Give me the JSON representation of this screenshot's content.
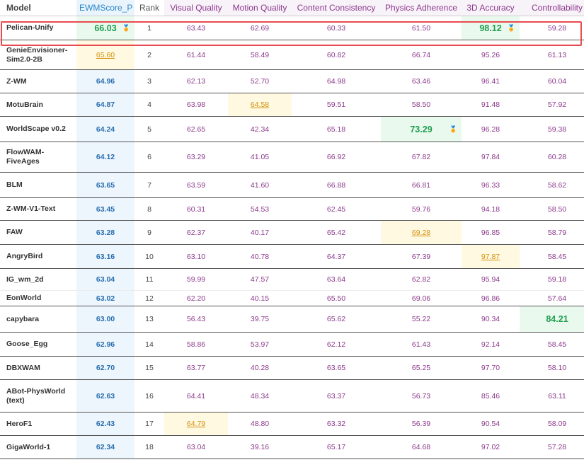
{
  "headers": {
    "model": "Model",
    "ewm": "EWMScore_P",
    "rank": "Rank",
    "visual_quality": "Visual Quality",
    "motion_quality": "Motion Quality",
    "content_consistency": "Content Consistency",
    "physics_adherence": "Physics Adherence",
    "accuracy_3d": "3D Accuracy",
    "controllability": "Controllability"
  },
  "rows": [
    {
      "model": "Pelican-Unify",
      "ewm": "66.03",
      "rank": "1",
      "vq": "63.43",
      "mq": "62.69",
      "cc": "60.33",
      "pa": "61.50",
      "ac": "98.12",
      "ct": "59.28"
    },
    {
      "model": "GenieEnvisioner-Sim2.0-2B",
      "ewm": "65.60",
      "rank": "2",
      "vq": "61.44",
      "mq": "58.49",
      "cc": "60.82",
      "pa": "66.74",
      "ac": "95.26",
      "ct": "61.13"
    },
    {
      "model": "Z-WM",
      "ewm": "64.96",
      "rank": "3",
      "vq": "62.13",
      "mq": "52.70",
      "cc": "64.98",
      "pa": "63.46",
      "ac": "96.41",
      "ct": "60.04"
    },
    {
      "model": "MotuBrain",
      "ewm": "64.87",
      "rank": "4",
      "vq": "63.98",
      "mq": "64.58",
      "cc": "59.51",
      "pa": "58.50",
      "ac": "91.48",
      "ct": "57.92"
    },
    {
      "model": "WorldScape v0.2",
      "ewm": "64.24",
      "rank": "5",
      "vq": "62.65",
      "mq": "42.34",
      "cc": "65.18",
      "pa": "73.29",
      "ac": "96.28",
      "ct": "59.38"
    },
    {
      "model": "FlowWAM-FiveAges",
      "ewm": "64.12",
      "rank": "6",
      "vq": "63.29",
      "mq": "41.05",
      "cc": "66.92",
      "pa": "67.82",
      "ac": "97.84",
      "ct": "60.28"
    },
    {
      "model": "BLM",
      "ewm": "63.65",
      "rank": "7",
      "vq": "63.59",
      "mq": "41.60",
      "cc": "66.88",
      "pa": "66.81",
      "ac": "96.33",
      "ct": "58.62"
    },
    {
      "model": "Z-WM-V1-Text",
      "ewm": "63.45",
      "rank": "8",
      "vq": "60.31",
      "mq": "54.53",
      "cc": "62.45",
      "pa": "59.76",
      "ac": "94.18",
      "ct": "58.50"
    },
    {
      "model": "FAW",
      "ewm": "63.28",
      "rank": "9",
      "vq": "62.37",
      "mq": "40.17",
      "cc": "65.42",
      "pa": "69.28",
      "ac": "96.85",
      "ct": "58.79"
    },
    {
      "model": "AngryBird",
      "ewm": "63.16",
      "rank": "10",
      "vq": "63.10",
      "mq": "40.78",
      "cc": "64.37",
      "pa": "67.39",
      "ac": "97.87",
      "ct": "58.45"
    },
    {
      "model": "IG_wm_2d",
      "ewm": "63.04",
      "rank": "11",
      "vq": "59.99",
      "mq": "47.57",
      "cc": "63.64",
      "pa": "62.82",
      "ac": "95.94",
      "ct": "59.18"
    },
    {
      "model": "EonWorld",
      "ewm": "63.02",
      "rank": "12",
      "vq": "62.20",
      "mq": "40.15",
      "cc": "65.50",
      "pa": "69.06",
      "ac": "96.86",
      "ct": "57.64"
    },
    {
      "model": "capybara",
      "ewm": "63.00",
      "rank": "13",
      "vq": "56.43",
      "mq": "39.75",
      "cc": "65.62",
      "pa": "55.22",
      "ac": "90.34",
      "ct": "84.21"
    },
    {
      "model": "Goose_Egg",
      "ewm": "62.96",
      "rank": "14",
      "vq": "58.86",
      "mq": "53.97",
      "cc": "62.12",
      "pa": "61.43",
      "ac": "92.14",
      "ct": "58.45"
    },
    {
      "model": "DBXWAM",
      "ewm": "62.70",
      "rank": "15",
      "vq": "63.77",
      "mq": "40.28",
      "cc": "63.65",
      "pa": "65.25",
      "ac": "97.70",
      "ct": "58.10"
    },
    {
      "model": "ABot-PhysWorld (text)",
      "ewm": "62.63",
      "rank": "16",
      "vq": "64.41",
      "mq": "48.34",
      "cc": "63.37",
      "pa": "56.73",
      "ac": "85.46",
      "ct": "63.11"
    },
    {
      "model": "HeroF1",
      "ewm": "62.43",
      "rank": "17",
      "vq": "64.79",
      "mq": "48.80",
      "cc": "63.32",
      "pa": "56.39",
      "ac": "90.54",
      "ct": "58.09"
    },
    {
      "model": "GigaWorld-1",
      "ewm": "62.34",
      "rank": "18",
      "vq": "63.04",
      "mq": "39.16",
      "cc": "65.17",
      "pa": "64.68",
      "ac": "97.02",
      "ct": "57.28"
    }
  ],
  "best_marker": "🏅",
  "colors": {
    "highlight_box": "#e84a4f",
    "best": "#1f9e4e",
    "second": "#d4900c",
    "ewm_text": "#2a6fb0",
    "metric_text": "#8c3a8c"
  }
}
